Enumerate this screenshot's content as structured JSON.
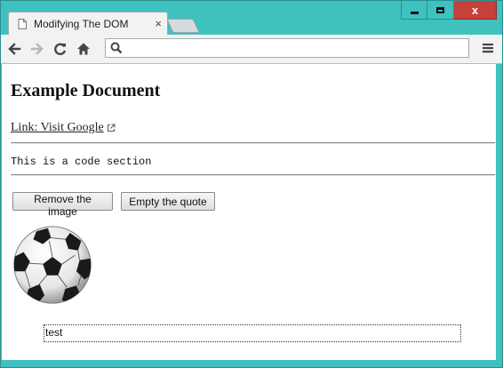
{
  "window": {
    "controls": {
      "minimize": "",
      "maximize": "",
      "close": "x"
    }
  },
  "tab": {
    "title": "Modifying The DOM",
    "close": "×"
  },
  "toolbar": {
    "back_icon": "back-arrow-icon",
    "forward_icon": "forward-arrow-icon",
    "reload_icon": "reload-icon",
    "home_icon": "home-icon",
    "address": {
      "value": "",
      "placeholder": ""
    },
    "menu_icon": "hamburger-menu-icon"
  },
  "page": {
    "heading": "Example Document",
    "link_text": "Link: Visit Google",
    "code_text": "This is a code section",
    "buttons": {
      "remove_image": "Remove the image",
      "empty_quote": "Empty the quote"
    },
    "image_icon": "soccer-ball-image",
    "quote_text": "test"
  },
  "colors": {
    "window_frame": "#3fc1bf",
    "close_button": "#c7403a",
    "tab_background": "#f2f2f2",
    "page_background": "#ffffff"
  }
}
